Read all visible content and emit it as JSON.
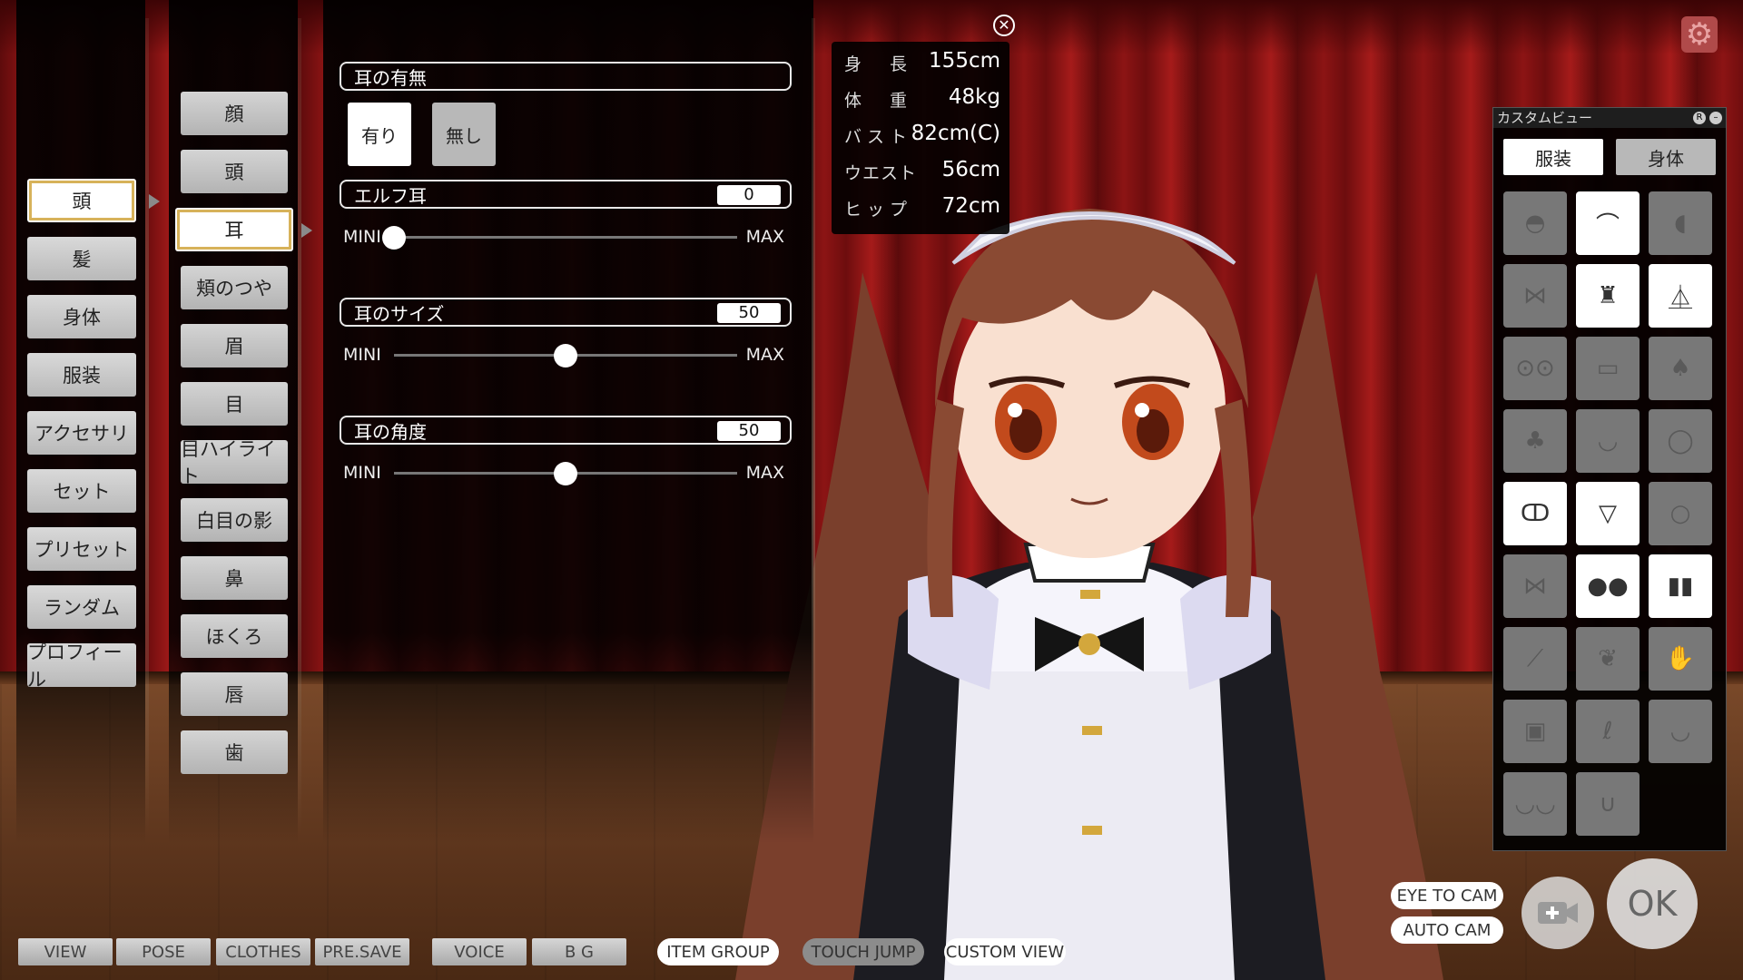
{
  "categories": [
    {
      "label": "頭",
      "active": true
    },
    {
      "label": "髪"
    },
    {
      "label": "身体"
    },
    {
      "label": "服装"
    },
    {
      "label": "アクセサリ"
    },
    {
      "label": "セット"
    },
    {
      "label": "プリセット"
    },
    {
      "label": "ランダム"
    },
    {
      "label": "プロフィール"
    }
  ],
  "subcategories": [
    {
      "label": "顔"
    },
    {
      "label": "頭"
    },
    {
      "label": "耳",
      "active": true
    },
    {
      "label": "頬のつや"
    },
    {
      "label": "眉"
    },
    {
      "label": "目"
    },
    {
      "label": "目ハイライト"
    },
    {
      "label": "白目の影"
    },
    {
      "label": "鼻"
    },
    {
      "label": "ほくろ"
    },
    {
      "label": "唇"
    },
    {
      "label": "歯"
    }
  ],
  "ear_panel": {
    "presence": {
      "label": "耳の有無",
      "yes": "有り",
      "no": "無し",
      "selected": "有り"
    },
    "elf": {
      "label": "エルフ耳",
      "value": "0",
      "level": 0
    },
    "size": {
      "label": "耳のサイズ",
      "value": "50",
      "level": 0.5
    },
    "angle": {
      "label": "耳の角度",
      "value": "50",
      "level": 0.5
    },
    "min_label": "MINI",
    "max_label": "MAX"
  },
  "stats": [
    {
      "key": "身　長",
      "value": "155cm"
    },
    {
      "key": "体　重",
      "value": "48kg"
    },
    {
      "key": "バスト",
      "value": "82cm(C)"
    },
    {
      "key": "ウエスト",
      "value": "56cm"
    },
    {
      "key": "ヒップ",
      "value": "72cm"
    }
  ],
  "custom_view": {
    "title": "カスタムビュー",
    "tab_clothes": "服装",
    "tab_body": "身体",
    "items": [
      {
        "icon": "hat-icon",
        "on": false
      },
      {
        "icon": "headband-icon",
        "on": true
      },
      {
        "icon": "hair-icon",
        "on": false
      },
      {
        "icon": "ribbon-icon",
        "on": false
      },
      {
        "icon": "maid-top-icon",
        "on": true
      },
      {
        "icon": "skirt-icon",
        "on": true
      },
      {
        "icon": "glasses-icon",
        "on": false
      },
      {
        "icon": "mask-icon",
        "on": false
      },
      {
        "icon": "dress-icon",
        "on": false
      },
      {
        "icon": "swimsuit-icon",
        "on": false
      },
      {
        "icon": "earring-icon",
        "on": false
      },
      {
        "icon": "collar-icon",
        "on": false
      },
      {
        "icon": "bra-icon",
        "on": true
      },
      {
        "icon": "panties-icon",
        "on": true
      },
      {
        "icon": "ring-icon",
        "on": false
      },
      {
        "icon": "bowtie-icon",
        "on": false
      },
      {
        "icon": "shoes-icon",
        "on": true
      },
      {
        "icon": "socks-icon",
        "on": true
      },
      {
        "icon": "arm-icon",
        "on": false
      },
      {
        "icon": "wings-icon",
        "on": false
      },
      {
        "icon": "gloves-icon",
        "on": false
      },
      {
        "icon": "belt-icon",
        "on": false
      },
      {
        "icon": "tail-icon",
        "on": false
      },
      {
        "icon": "necklace-icon",
        "on": false
      },
      {
        "icon": "piercing-icon",
        "on": false
      },
      {
        "icon": "hook-icon",
        "on": false
      }
    ]
  },
  "bottom_bar": {
    "view": "VIEW",
    "pose": "POSE",
    "clothes": "CLOTHES",
    "presave": "PRE.SAVE",
    "voice": "VOICE",
    "bg": "B G",
    "item_group": "ITEM GROUP",
    "touch_jump": "TOUCH JUMP",
    "custom_view": "CUSTOM VIEW",
    "eye_to_cam": "EYE TO CAM",
    "auto_cam": "AUTO CAM",
    "ok": "OK"
  },
  "colors": {
    "accent_gold": "#d7b25a",
    "curtain": "#8c1414",
    "panel": "#000000"
  }
}
